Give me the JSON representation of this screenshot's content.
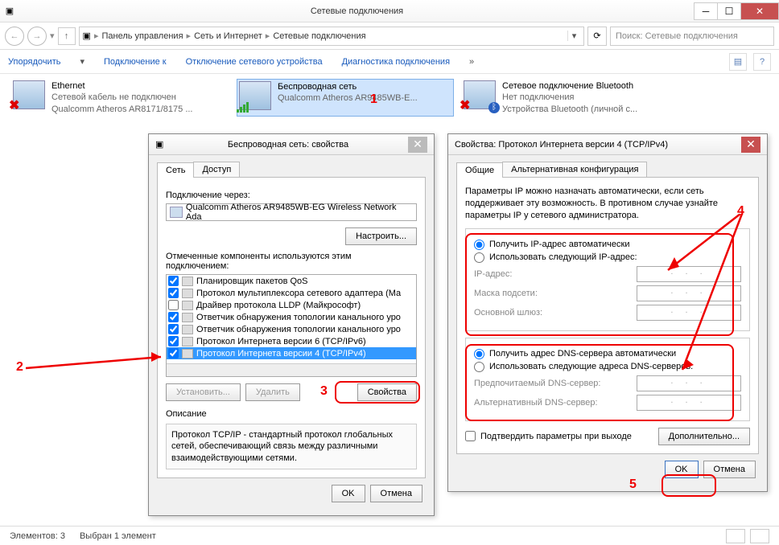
{
  "window": {
    "title": "Сетевые подключения",
    "breadcrumb": [
      "Панель управления",
      "Сеть и Интернет",
      "Сетевые подключения"
    ],
    "search_placeholder": "Поиск: Сетевые подключения"
  },
  "cmdbar": {
    "organize": "Упорядочить",
    "connect": "Подключение к",
    "disable": "Отключение сетевого устройства",
    "diagnose": "Диагностика подключения"
  },
  "connections": [
    {
      "name": "Ethernet",
      "status": "Сетевой кабель не подключен",
      "device": "Qualcomm Atheros AR8171/8175 ...",
      "x": true
    },
    {
      "name": "Беспроводная сеть",
      "status": "",
      "device": "Qualcomm Atheros AR9485WB-E...",
      "bars": true,
      "selected": true
    },
    {
      "name": "Сетевое подключение Bluetooth",
      "status": "Нет подключения",
      "device": "Устройства Bluetooth (личной с...",
      "bt": true
    }
  ],
  "anno": {
    "n1": "1",
    "n2": "2",
    "n3": "3",
    "n4": "4",
    "n5": "5"
  },
  "dlg1": {
    "title": "Беспроводная сеть: свойства",
    "tabs": [
      "Сеть",
      "Доступ"
    ],
    "connect_label": "Подключение через:",
    "adapter": "Qualcomm Atheros AR9485WB-EG Wireless Network Ada",
    "configure": "Настроить...",
    "components_label": "Отмеченные компоненты используются этим подключением:",
    "items": [
      {
        "c": true,
        "t": "Планировщик пакетов QoS"
      },
      {
        "c": true,
        "t": "Протокол мультиплексора сетевого адаптера (Ма"
      },
      {
        "c": false,
        "t": "Драйвер протокола LLDP (Майкрософт)"
      },
      {
        "c": true,
        "t": "Ответчик обнаружения топологии канального уро"
      },
      {
        "c": true,
        "t": "Ответчик обнаружения топологии канального уро"
      },
      {
        "c": true,
        "t": "Протокол Интернета версии 6 (TCP/IPv6)"
      },
      {
        "c": true,
        "t": "Протокол Интернета версии 4 (TCP/IPv4)",
        "sel": true
      }
    ],
    "install": "Установить...",
    "remove": "Удалить",
    "props": "Свойства",
    "desc_label": "Описание",
    "desc": "Протокол TCP/IP - стандартный протокол глобальных сетей, обеспечивающий связь между различными взаимодействующими сетями.",
    "ok": "OK",
    "cancel": "Отмена"
  },
  "dlg2": {
    "title": "Свойства: Протокол Интернета версии 4 (TCP/IPv4)",
    "tabs": [
      "Общие",
      "Альтернативная конфигурация"
    ],
    "intro": "Параметры IP можно назначать автоматически, если сеть поддерживает эту возможность. В противном случае узнайте параметры IP у сетевого администратора.",
    "ip_auto": "Получить IP-адрес автоматически",
    "ip_manual": "Использовать следующий IP-адрес:",
    "ip_addr": "IP-адрес:",
    "mask": "Маска подсети:",
    "gateway": "Основной шлюз:",
    "dns_auto": "Получить адрес DNS-сервера автоматически",
    "dns_manual": "Использовать следующие адреса DNS-серверов:",
    "dns_pref": "Предпочитаемый DNS-сервер:",
    "dns_alt": "Альтернативный DNS-сервер:",
    "confirm": "Подтвердить параметры при выходе",
    "advanced": "Дополнительно...",
    "ok": "OK",
    "cancel": "Отмена",
    "dots": ".   .   ."
  },
  "status": {
    "items": "Элементов: 3",
    "selected": "Выбран 1 элемент"
  }
}
